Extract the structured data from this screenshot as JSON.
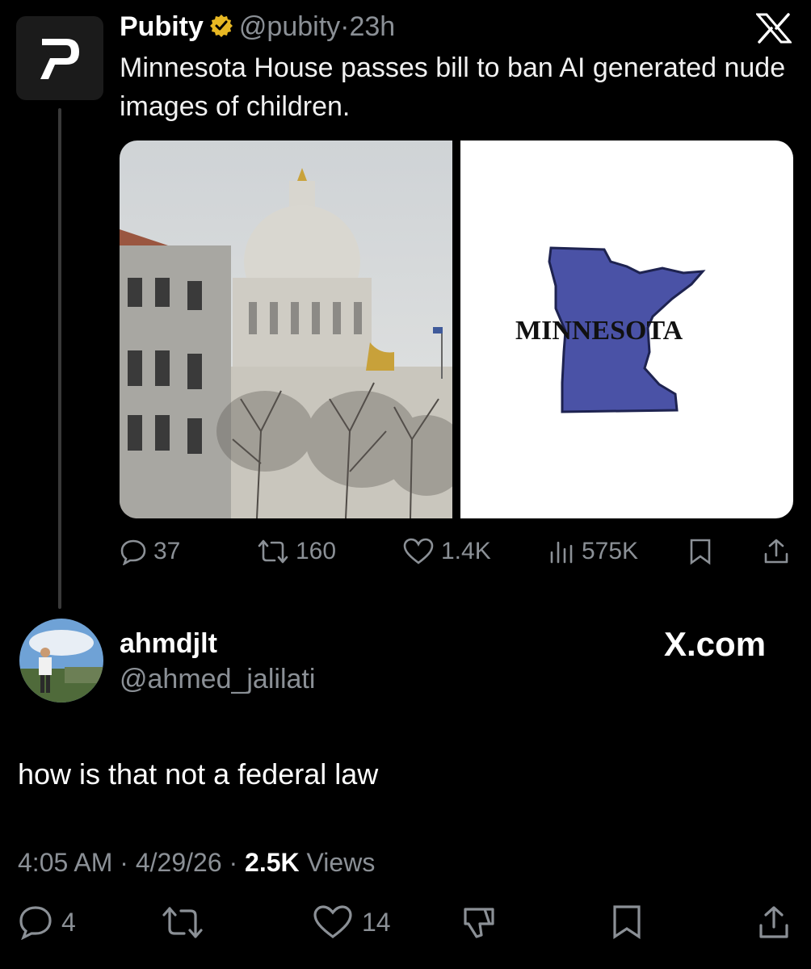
{
  "tweet": {
    "author_name": "Pubity",
    "handle": "@pubity",
    "separator": "·",
    "time": "23h",
    "text": "Minnesota House passes bill to ban AI generated nude images of children.",
    "media_right_label": "MINNESOTA",
    "actions": {
      "replies": "37",
      "reposts": "160",
      "likes": "1.4K",
      "views": "575K"
    }
  },
  "reply": {
    "author_name": "ahmdjlt",
    "handle": "@ahmed_jalilati",
    "brand": "X.com",
    "text": "how is that not a federal law",
    "meta": {
      "time": "4:05 AM",
      "dot1": "·",
      "date": "4/29/26",
      "dot2": "·",
      "views_count": "2.5K",
      "views_label": "Views"
    },
    "actions": {
      "replies": "4",
      "likes": "14"
    }
  },
  "colors": {
    "background": "#000000",
    "muted": "#8b9096",
    "verified": "#e8b823",
    "minnesota_state": "#4a52a6"
  }
}
